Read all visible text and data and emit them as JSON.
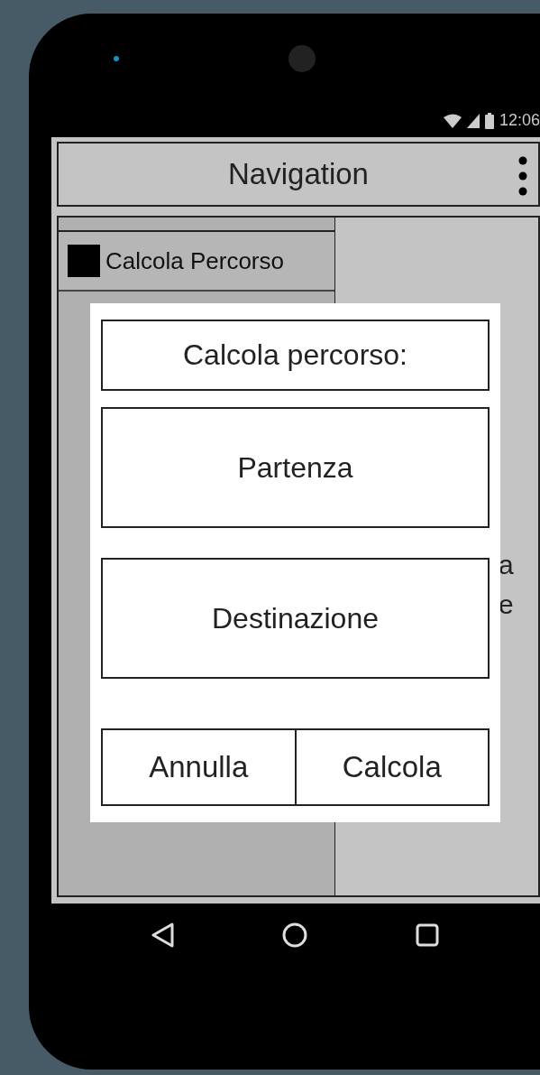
{
  "status_bar": {
    "time": "12:06"
  },
  "app_bar": {
    "title": "Navigation"
  },
  "drawer": {
    "items": [
      {
        "label": "Calcola Percorso"
      }
    ]
  },
  "content": {
    "fragments": [
      "a",
      "e"
    ]
  },
  "dialog": {
    "title": "Calcola percorso:",
    "fields": [
      {
        "placeholder": "Partenza"
      },
      {
        "placeholder": "Destinazione"
      }
    ],
    "buttons": [
      "Annulla",
      "Calcola"
    ]
  }
}
